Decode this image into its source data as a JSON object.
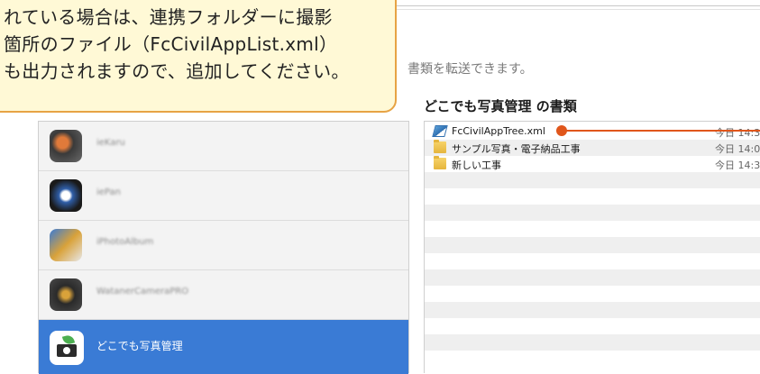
{
  "callout": {
    "lines": [
      "れている場合は、連携フォルダーに撮影",
      "箇所のファイル（FcCivilAppList.xml）",
      "も出力されますので、追加してください。"
    ]
  },
  "subtitle": "書類を転送できます。",
  "panel_title": "どこでも写真管理 の書類",
  "apps": [
    {
      "name": "ieKaru",
      "icon": "app-icon-1"
    },
    {
      "name": "iePan",
      "icon": "app-icon-2"
    },
    {
      "name": "iPhotoAlbum",
      "icon": "app-icon-3"
    },
    {
      "name": "WatanerCameraPRO",
      "icon": "app-icon-4"
    },
    {
      "name": "どこでも写真管理",
      "icon": "camera-icon",
      "selected": true
    }
  ],
  "documents": [
    {
      "name": "FcCivilAppTree.xml",
      "date": "今日 14:3",
      "type": "xml"
    },
    {
      "name": "サンプル写真・電子納品工事",
      "date": "今日 14:0",
      "type": "folder"
    },
    {
      "name": "新しい工事",
      "date": "今日 14:3",
      "type": "folder"
    }
  ],
  "colors": {
    "selection": "#3a7bd5",
    "callout_border": "#e7a344",
    "callout_bg": "#fff9d6",
    "marker": "#e0561b"
  }
}
